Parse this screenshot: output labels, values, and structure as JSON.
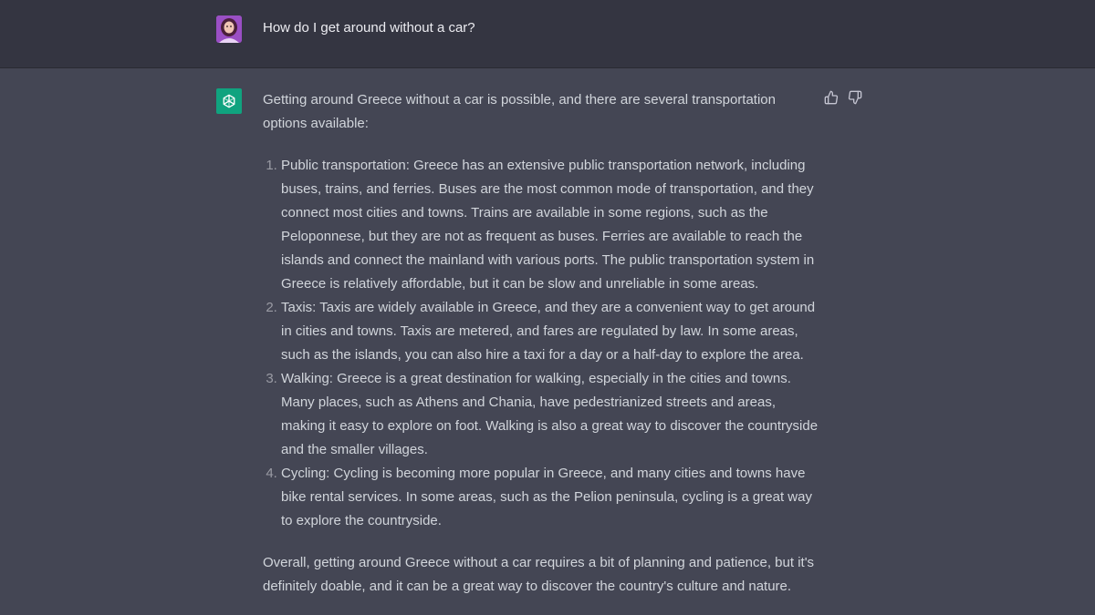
{
  "user_message": {
    "text": "How do I get around without a car?"
  },
  "assistant_message": {
    "intro": "Getting around Greece without a car is possible, and there are several transportation options available:",
    "items": [
      "Public transportation: Greece has an extensive public transportation network, including buses, trains, and ferries. Buses are the most common mode of transportation, and they connect most cities and towns. Trains are available in some regions, such as the Peloponnese, but they are not as frequent as buses. Ferries are available to reach the islands and connect the mainland with various ports. The public transportation system in Greece is relatively affordable, but it can be slow and unreliable in some areas.",
      "Taxis: Taxis are widely available in Greece, and they are a convenient way to get around in cities and towns. Taxis are metered, and fares are regulated by law. In some areas, such as the islands, you can also hire a taxi for a day or a half-day to explore the area.",
      "Walking: Greece is a great destination for walking, especially in the cities and towns. Many places, such as Athens and Chania, have pedestrianized streets and areas, making it easy to explore on foot. Walking is also a great way to discover the countryside and the smaller villages.",
      "Cycling: Cycling is becoming more popular in Greece, and many cities and towns have bike rental services. In some areas, such as the Pelion peninsula, cycling is a great way to explore the countryside."
    ],
    "conclusion": "Overall, getting around Greece without a car requires a bit of planning and patience, but it's definitely doable, and it can be a great way to discover the country's culture and nature."
  },
  "icons": {
    "user_avatar": "user-avatar",
    "assistant_avatar": "openai-logo-icon",
    "feedback_up": "thumbs-up-icon",
    "feedback_down": "thumbs-down-icon"
  },
  "colors": {
    "user_row_bg": "#343541",
    "assistant_row_bg": "#444654",
    "assistant_avatar_bg": "#10a37f",
    "text": "#d1d5db"
  }
}
